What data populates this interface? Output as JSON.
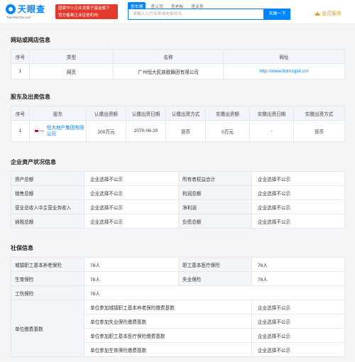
{
  "header": {
    "logo_text": "天眼查",
    "logo_sub": "TianYanCha.com",
    "banner_line1": "国家中小企业发展子基金旗下",
    "banner_line2": "官方备案企业征信机构",
    "search_tabs": [
      "查车辆",
      "查公司",
      "查老板",
      "查关系"
    ],
    "search_placeholder": "请输入公司名称或老板姓名",
    "search_button": "天眼一下",
    "member_label": "会员服务"
  },
  "website_section": {
    "title": "网站或网店信息",
    "headers": [
      "序号",
      "类型",
      "名称",
      "网址"
    ],
    "rows": [
      {
        "index": "1",
        "type": "网页",
        "name": "广州恒大民族歌舞团有限公司",
        "url": "http://www.hdmzgwt.cn/"
      }
    ]
  },
  "shareholder_section": {
    "title": "股东及出资信息",
    "headers": [
      "序号",
      "股东",
      "认缴出资额",
      "认缴出资日期",
      "认缴出资方式",
      "实缴出资额",
      "实缴出资日期",
      "实缴出资方式"
    ],
    "rows": [
      {
        "index": "1",
        "name": "恒大地产集团有限公司",
        "subscribed_amount": "200万元",
        "subscribed_date": "2070-06-20",
        "subscribed_method": "货币",
        "paid_amount": "0万元",
        "paid_date": "-",
        "paid_method": "货币"
      }
    ]
  },
  "assets_section": {
    "title": "企业资产状况信息",
    "rows": [
      {
        "l1": "资产总额",
        "v1": "企业选择不公示",
        "l2": "所有者权益合计",
        "v2": "企业选择不公示"
      },
      {
        "l1": "销售总额",
        "v1": "企业选择不公示",
        "l2": "利润总额",
        "v2": "企业选择不公示"
      },
      {
        "l1": "营业总收入中主营业务收入",
        "v1": "企业选择不公示",
        "l2": "净利润",
        "v2": "企业选择不公示"
      },
      {
        "l1": "纳税总额",
        "v1": "企业选择不公示",
        "l2": "负债总额",
        "v2": "企业选择不公示"
      }
    ]
  },
  "social_section": {
    "title": "社保信息",
    "rows": [
      {
        "l1": "城镇职工基本养老保险",
        "v1": "78人",
        "l2": "职工基本医疗保险",
        "v2": "78人"
      },
      {
        "l1": "生育保险",
        "v1": "78人",
        "l2": "失业保险",
        "v2": "78人"
      }
    ],
    "injury_label": "工伤保险",
    "injury_value": "78人",
    "payment_label": "单位缴费基数",
    "payment_rows": [
      {
        "item": "单位参加城镇职工基本养老保险缴费基数",
        "value": "企业选择不公示"
      },
      {
        "item": "单位参加失业保险缴费基数",
        "value": "企业选择不公示"
      },
      {
        "item": "单位参加职工基本医疗保险缴费基数",
        "value": "企业选择不公示"
      },
      {
        "item": "单位参加生育保险缴费基数",
        "value": "企业选择不公示"
      }
    ]
  }
}
